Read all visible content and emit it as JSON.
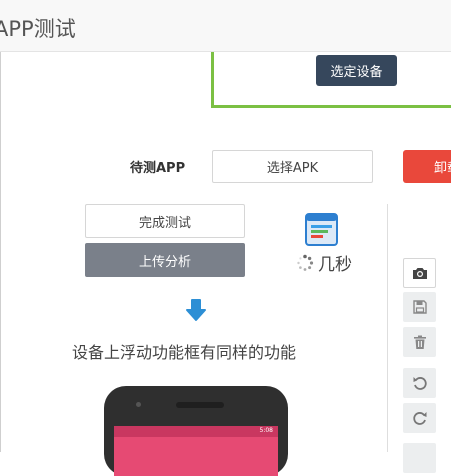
{
  "window": {
    "title": "APP测试"
  },
  "device": {
    "select_button": "选定设备"
  },
  "app": {
    "label": "待测APP",
    "choose_apk_button": "选择APK",
    "uninstall_button": "卸载"
  },
  "test": {
    "finish_button": "完成测试",
    "upload_button": "上传分析",
    "loading_text": "几秒"
  },
  "hint": {
    "caption": "设备上浮动功能框有同样的功能"
  },
  "toolbar": {
    "tools": [
      "camera-icon",
      "save-icon",
      "delete-icon",
      "rotate-left-icon",
      "rotate-right-icon"
    ]
  },
  "phone": {
    "status_time": "5:08"
  },
  "colors": {
    "primary_dark": "#36475c",
    "danger": "#e9483b",
    "accent_green": "#7bc043",
    "gray_button": "#7a808a",
    "arrow_blue": "#2d8fd5",
    "phone_pink": "#e64a73"
  }
}
